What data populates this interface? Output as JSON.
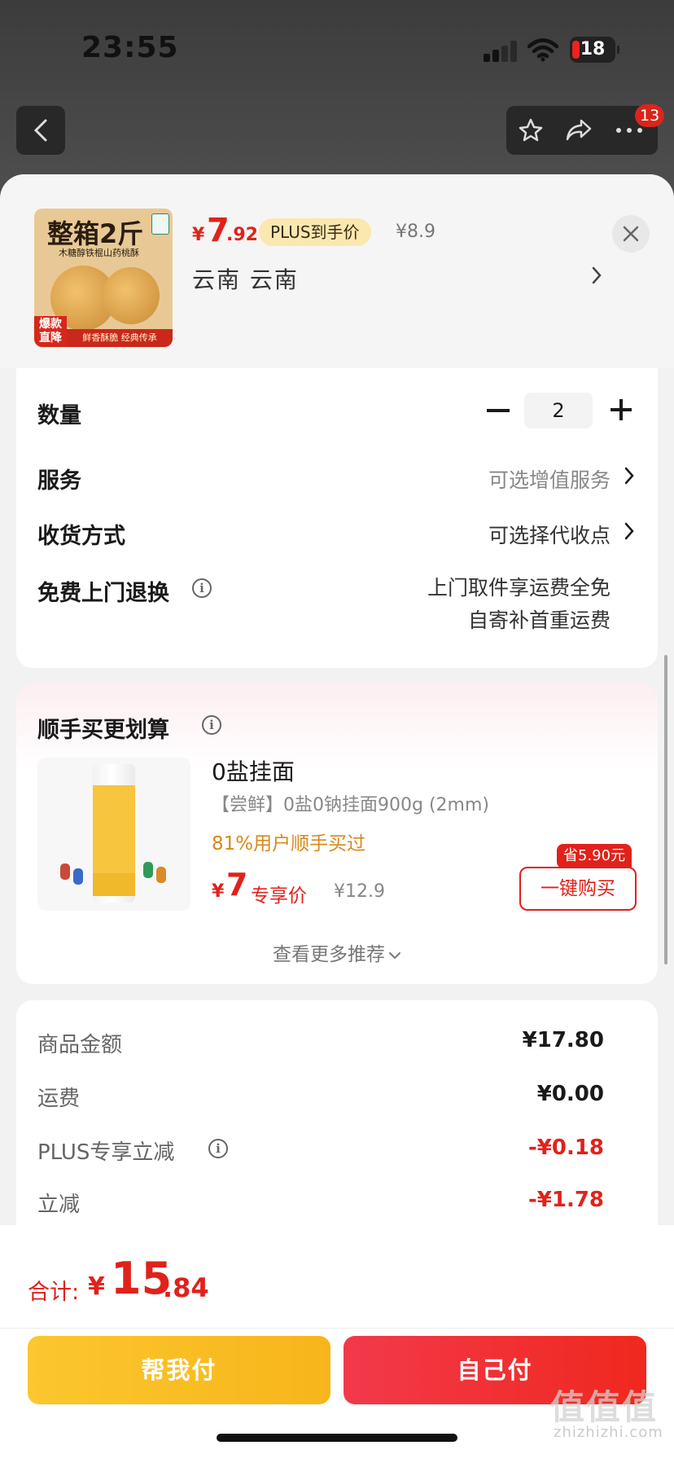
{
  "status_bar": {
    "time": "23:55",
    "battery": "18"
  },
  "nav": {
    "badge_count": "13"
  },
  "product": {
    "image_title": "整箱2斤",
    "image_subtitle": "木糖醇铁棍山药桃酥",
    "image_badge": "爆款直降",
    "image_footer": "鲜香酥脆 经典传承",
    "price_currency": "¥",
    "price_int": "7",
    "price_dec": ".92",
    "plus_tag": "PLUS到手价",
    "original_price": "¥8.9",
    "location": "云南  云南"
  },
  "options": {
    "quantity_label": "数量",
    "quantity_value": "2",
    "service_label": "服务",
    "service_value": "可选增值服务",
    "delivery_label": "收货方式",
    "delivery_value": "可选择代收点",
    "return_label": "免费上门退换",
    "return_line1": "上门取件享运费全免",
    "return_line2": "自寄补首重运费"
  },
  "recommend": {
    "title": "顺手买更划算",
    "item_name": "0盐挂面",
    "item_desc": "【尝鲜】0盐0钠挂面900g (2mm)",
    "item_stat": "81%用户顺手买过",
    "price_currency": "¥",
    "price": "7",
    "price_label": "专享价",
    "original_price": "¥12.9",
    "save_tag": "省5.90元",
    "buy_button": "一键购买",
    "more_link": "查看更多推荐"
  },
  "summary": {
    "rows": [
      {
        "label": "商品金额",
        "value": "¥17.80",
        "red": false
      },
      {
        "label": "运费",
        "value": "¥0.00",
        "red": false
      },
      {
        "label": "PLUS专享立减",
        "value": "-¥0.18",
        "red": true
      },
      {
        "label": "立减",
        "value": "-¥1.78",
        "red": true
      }
    ]
  },
  "footer": {
    "total_label": "合计:",
    "total_currency": "¥",
    "total_int": "15",
    "total_dec": ".84",
    "help_pay": "帮我付",
    "self_pay": "自己付"
  },
  "watermark": {
    "text": "值值值",
    "sub": "zhizhizhi.com"
  },
  "colors": {
    "accent_red": "#e0221b",
    "plus_gold": "#fbe7b0",
    "help_yellow": "#fbc72e",
    "stat_orange": "#d7881d"
  }
}
